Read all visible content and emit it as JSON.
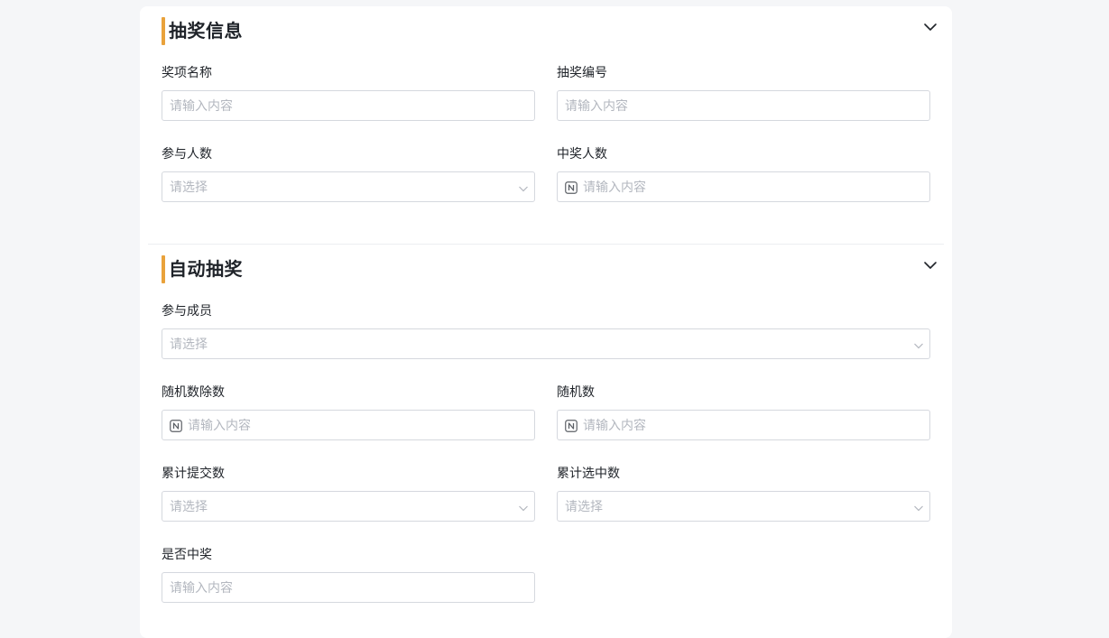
{
  "sections": [
    {
      "title": "抽奖信息",
      "fields": {
        "prize_name": {
          "label": "奖项名称",
          "placeholder": "请输入内容"
        },
        "lottery_no": {
          "label": "抽奖编号",
          "placeholder": "请输入内容"
        },
        "participants": {
          "label": "参与人数",
          "placeholder": "请选择"
        },
        "winners": {
          "label": "中奖人数",
          "placeholder": "请输入内容"
        }
      }
    },
    {
      "title": "自动抽奖",
      "fields": {
        "members": {
          "label": "参与成员",
          "placeholder": "请选择"
        },
        "random_divisor": {
          "label": "随机数除数",
          "placeholder": "请输入内容"
        },
        "random_number": {
          "label": "随机数",
          "placeholder": "请输入内容"
        },
        "total_submits": {
          "label": "累计提交数",
          "placeholder": "请选择"
        },
        "total_selected": {
          "label": "累计选中数",
          "placeholder": "请选择"
        },
        "is_winner": {
          "label": "是否中奖",
          "placeholder": "请输入内容"
        }
      }
    }
  ],
  "colors": {
    "accent_bar": "#e9a23b",
    "placeholder": "#b3b7bf",
    "border": "#d5d8de",
    "background": "#f5f6f8"
  },
  "icons": {
    "collapse": "chevron-down-icon",
    "number": "number-icon",
    "select": "select-arrow-icon"
  }
}
